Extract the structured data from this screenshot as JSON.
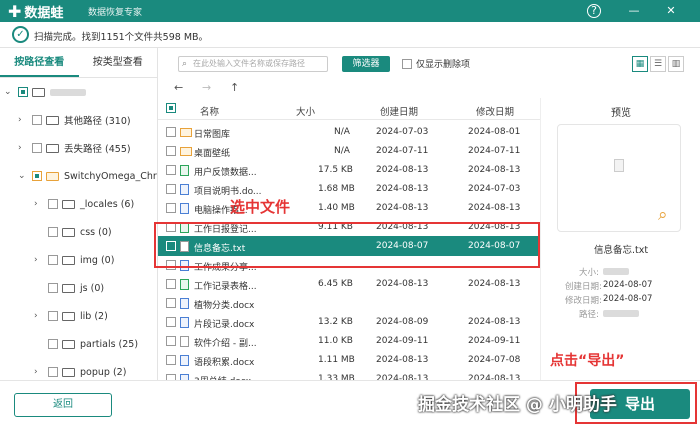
{
  "app": {
    "name": "数据蛙",
    "subtitle": "数据恢复专家",
    "help": "?",
    "min": "—",
    "close": "✕"
  },
  "status": {
    "text": "扫描完成。找到1151个文件共598 MB。"
  },
  "tabs": [
    "按路径查看",
    "按类型查看"
  ],
  "tree": {
    "other_paths": "其他路径 (310)",
    "lost_paths": "丢失路径 (455)",
    "omega": "SwitchyOmega_Chrom",
    "locales": "_locales (6)",
    "css": "css (0)",
    "img": "img (0)",
    "js": "js (0)",
    "lib": "lib (2)",
    "partials": "partials (25)",
    "popup": "popup (2)"
  },
  "toolbar": {
    "search_placeholder": "在此处输入文件名称或保存路径",
    "filter": "筛选器",
    "delete_only": "仅显示删除项"
  },
  "columns": {
    "name": "名称",
    "size": "大小",
    "created": "创建日期",
    "modified": "修改日期"
  },
  "files": [
    {
      "name": "日常图库",
      "size": "N/A",
      "created": "2024-07-03",
      "modified": "2024-08-01",
      "icon": "folder"
    },
    {
      "name": "桌面壁纸",
      "size": "N/A",
      "created": "2024-07-11",
      "modified": "2024-07-11",
      "icon": "folder"
    },
    {
      "name": "用户反馈数据...",
      "size": "17.5 KB",
      "created": "2024-08-13",
      "modified": "2024-08-13",
      "icon": "xls"
    },
    {
      "name": "项目说明书.do...",
      "size": "1.68 MB",
      "created": "2024-08-13",
      "modified": "2024-07-03",
      "icon": "doc"
    },
    {
      "name": "电脑操作指...",
      "size": "1.40 MB",
      "created": "2024-08-13",
      "modified": "2024-08-13",
      "icon": "doc"
    },
    {
      "name": "工作日报登记...",
      "size": "9.11 KB",
      "created": "2024-08-13",
      "modified": "2024-08-13",
      "icon": "xls"
    },
    {
      "name": "信息备忘.txt",
      "size": "",
      "created": "2024-08-07",
      "modified": "2024-08-07",
      "icon": "txt"
    },
    {
      "name": "工作成果分享...",
      "size": "",
      "created": "",
      "modified": "",
      "icon": "doc"
    },
    {
      "name": "工作记录表格...",
      "size": "6.45 KB",
      "created": "2024-08-13",
      "modified": "2024-08-13",
      "icon": "xls"
    },
    {
      "name": "植物分类.docx",
      "size": "",
      "created": "",
      "modified": "",
      "icon": "doc"
    },
    {
      "name": "片段记录.docx",
      "size": "13.2 KB",
      "created": "2024-08-09",
      "modified": "2024-08-13",
      "icon": "doc"
    },
    {
      "name": "软件介绍 - 副...",
      "size": "11.0 KB",
      "created": "2024-09-11",
      "modified": "2024-09-11",
      "icon": "txt"
    },
    {
      "name": "语段积累.docx",
      "size": "1.11 MB",
      "created": "2024-08-13",
      "modified": "2024-07-08",
      "icon": "doc"
    },
    {
      "name": "3周总结.docx",
      "size": "1.33 MB",
      "created": "2024-08-13",
      "modified": "2024-08-13",
      "icon": "doc"
    }
  ],
  "preview": {
    "title": "预览",
    "filename": "信息备忘.txt",
    "size_label": "大小:",
    "created_label": "创建日期:",
    "modified_label": "修改日期:",
    "path_label": "路径:",
    "created": "2024-08-07",
    "modified": "2024-08-07"
  },
  "buttons": {
    "back": "返回",
    "export": "导出"
  },
  "annotations": {
    "select": "选中文件",
    "export_hint": "点击“导出”"
  },
  "watermark": "掘金技术社区 @ 小明助手",
  "colors": {
    "accent": "#1a8a7e",
    "annotation": "#e53535"
  }
}
